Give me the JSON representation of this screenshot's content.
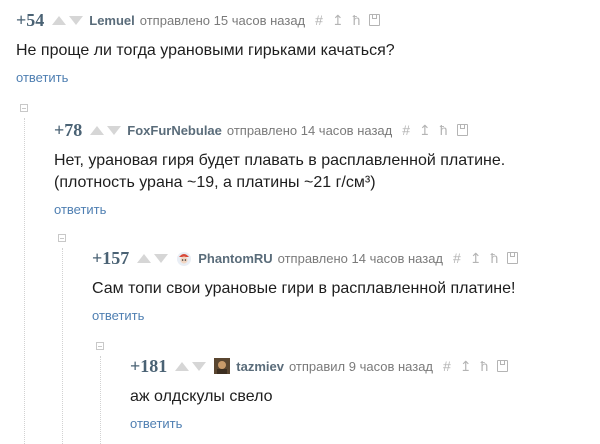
{
  "comments": [
    {
      "score": "+54",
      "author": "Lemuel",
      "status": "отправлено 15 часов назад",
      "text": "Не проще ли тогда урановыми гирьками качаться?",
      "reply": "ответить"
    },
    {
      "score": "+78",
      "author": "FoxFurNebulae",
      "status": "отправлено 14 часов назад",
      "text_lines": [
        "Нет, урановая гиря будет плавать в расплавленной платине.",
        "(плотность урана ~19, а платины ~21 г/см³)"
      ],
      "reply": "ответить"
    },
    {
      "score": "+157",
      "author": "PhantomRU",
      "status": "отправлено 14 часов назад",
      "text": "Сам топи свои урановые гири в расплавленной платине!",
      "reply": "ответить"
    },
    {
      "score": "+181",
      "author": "tazmiev",
      "status": "отправил 9 часов назад",
      "text": "аж олдскулы свело",
      "reply": "ответить"
    }
  ],
  "icons": {
    "hash": "#",
    "share": "↥",
    "tree": "ħ"
  },
  "colors": {
    "score": "#4a6274",
    "author": "#5a6c7a",
    "link": "#4f7fb2",
    "muted": "#b4b4b4"
  }
}
